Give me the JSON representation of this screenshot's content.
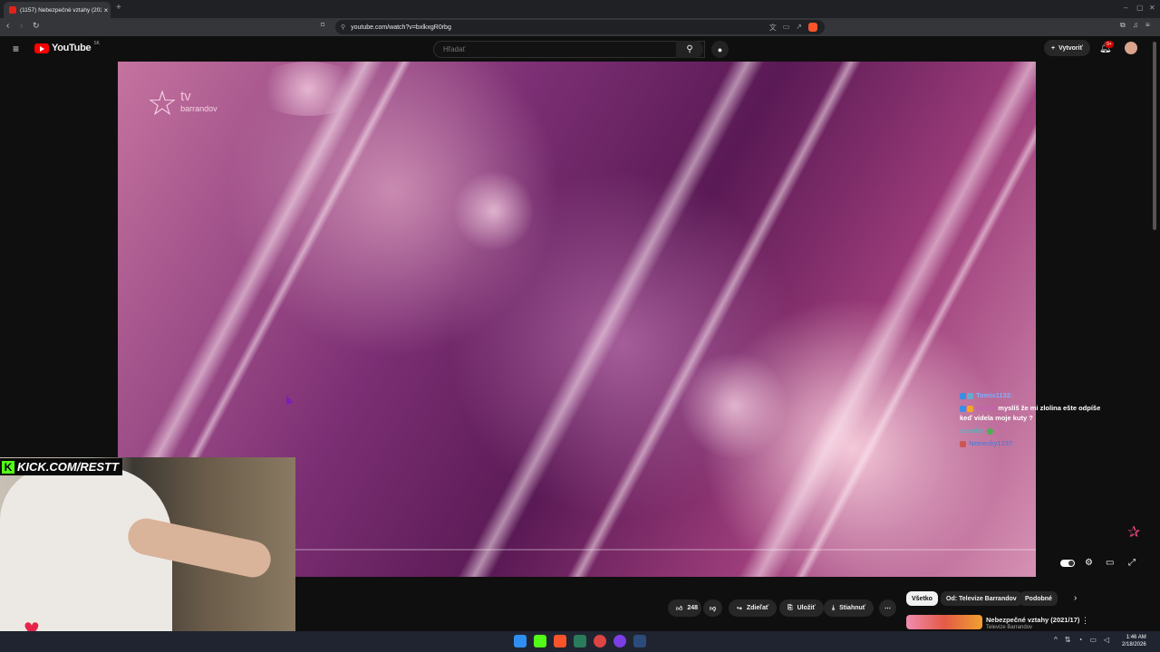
{
  "browser": {
    "tab_title": "(1157) Nebezpečné vztahy (202...",
    "tab_close": "×",
    "new_tab": "+",
    "url": "youtube.com/watch?v=bxlkxgR0rbg",
    "window_controls": [
      "–",
      "▢",
      "✕"
    ]
  },
  "header": {
    "logo_text": "YouTube",
    "country_code": "SK",
    "search_placeholder": "Hľadať",
    "create_label": "Vytvoriť",
    "notification_count": "9+"
  },
  "video": {
    "channel_logo_brand": "barrandov",
    "channel_logo_tv": "tv"
  },
  "chat": {
    "messages": [
      {
        "user": "Tomix1132:",
        "text": ""
      },
      {
        "user": "olin38:",
        "text": "myslíš že mi zlolina ešte odpíše keď videla moje kuty ?"
      },
      {
        "user": "sepiako:",
        "text": ""
      },
      {
        "user": "Nemecky1337:",
        "text": ""
      }
    ]
  },
  "webcam": {
    "banner_text": "KICK.COM/RESTT",
    "banner_logo": "K"
  },
  "actions": {
    "likes": "248",
    "share": "Zdieľať",
    "save": "Uložiť",
    "download": "Stiahnuť",
    "more": "⋯"
  },
  "recommendations": {
    "chips": [
      "Všetko",
      "Od: Televize Barrandov",
      "Podobné"
    ],
    "first_title": "Nebezpečné vztahy (2021/17)",
    "first_channel": "Televize Barrandov"
  },
  "taskbar": {
    "time": "1:46 AM",
    "date": "2/18/2026"
  },
  "colors": {
    "youtube_red": "#ff0000",
    "kick_green": "#53fc18",
    "background": "#0f0f0f"
  }
}
